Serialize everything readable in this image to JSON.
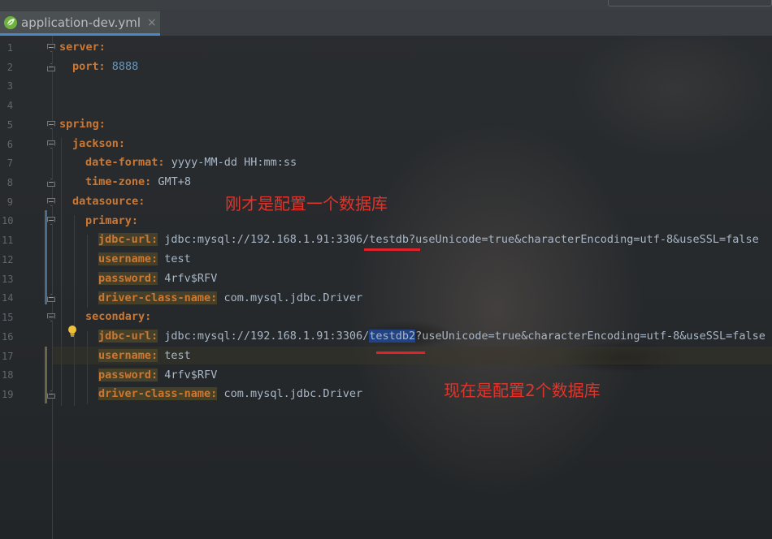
{
  "tab": {
    "label": "application-dev.yml",
    "close_glyph": "×",
    "icon": "spring-leaf-icon"
  },
  "line_numbers": [
    "1",
    "2",
    "3",
    "4",
    "5",
    "6",
    "7",
    "8",
    "9",
    "10",
    "11",
    "12",
    "13",
    "14",
    "15",
    "16",
    "17",
    "18",
    "19"
  ],
  "code": {
    "l1_key": "server:",
    "l2_key": "port:",
    "l2_val": "8888",
    "l5_key": "spring:",
    "l6_key": "jackson:",
    "l7_key": "date-format:",
    "l7_val": "yyyy-MM-dd HH:mm:ss",
    "l8_key": "time-zone:",
    "l8_val": "GMT+8",
    "l9_key": "datasource:",
    "l10_key": "primary:",
    "l11_key": "jdbc-url:",
    "l11_val_a": "jdbc:mysql://192.168.1.91:3306/",
    "l11_val_b": "testdb",
    "l11_val_c": "?useUnicode=true&characterEncoding=utf-8&useSSL=false",
    "l12_key": "username:",
    "l12_val": "test",
    "l13_key": "password:",
    "l13_val": "4rfv$RFV",
    "l14_key": "driver-class-name:",
    "l14_val": "com.mysql.jdbc.Driver",
    "l15_key": "secondary:",
    "l16_key": "jdbc-url:",
    "l16_val_a": "jdbc:mysql://192.168.1.91:3306/",
    "l16_val_b": "testdb2",
    "l16_val_c": "?useUnicode=true&characterEncoding=utf-8&useSSL=false",
    "l17_key": "username:",
    "l17_val": "test",
    "l18_key": "password:",
    "l18_val": "4rfv$RFV",
    "l19_key": "driver-class-name:",
    "l19_val": "com.mysql.jdbc.Driver"
  },
  "annotations": {
    "note_one": "刚才是配置一个数据库",
    "note_two": "现在是配置2个数据库"
  },
  "colors": {
    "keyword": "#cc7832",
    "value": "#a9b7c6",
    "number": "#6897bb",
    "annotation": "#e0352b",
    "selection": "#214283"
  }
}
